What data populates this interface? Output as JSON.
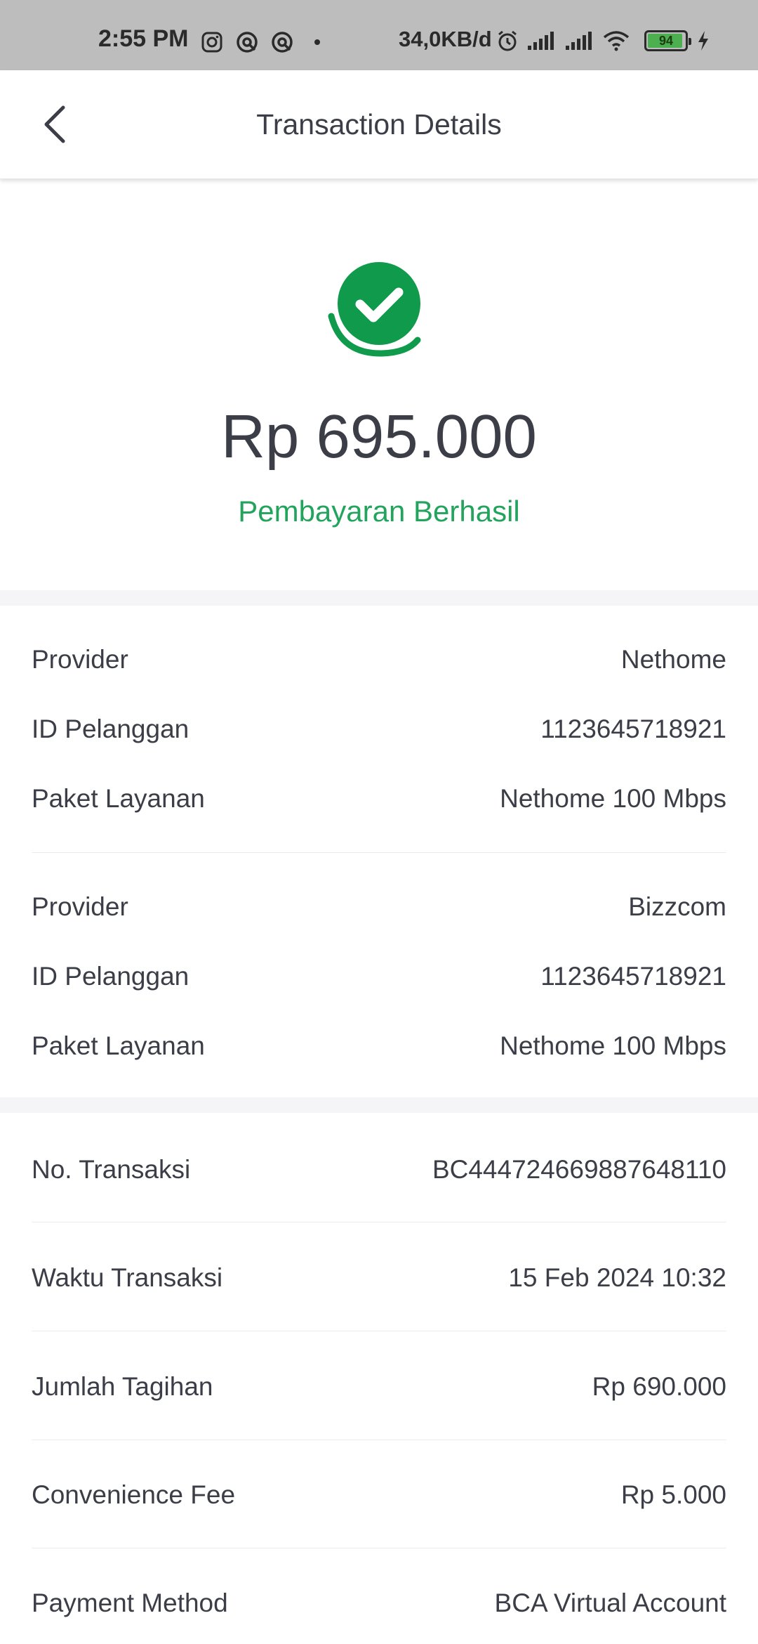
{
  "status_bar": {
    "time": "2:55 PM",
    "net_speed": "34,0KB/d",
    "battery": "94",
    "battery_level": 0.94,
    "icons": [
      "instagram-icon",
      "app-icon",
      "app-icon",
      "alarm-icon",
      "signal-icon",
      "signal-icon",
      "wifi-icon",
      "battery-icon",
      "charging-icon"
    ]
  },
  "header": {
    "title": "Transaction Details",
    "back_icon": "chevron-left-icon"
  },
  "summary": {
    "amount": "Rp 695.000",
    "status": "Pembayaran Berhasil",
    "status_color": "#22a45d",
    "icon_color": "#0f9b4b"
  },
  "services": [
    {
      "provider_label": "Provider",
      "provider": "Nethome",
      "customer_id_label": "ID Pelanggan",
      "customer_id": "1123645718921",
      "package_label": "Paket Layanan",
      "package": "Nethome 100 Mbps"
    },
    {
      "provider_label": "Provider",
      "provider": "Bizzcom",
      "customer_id_label": "ID Pelanggan",
      "customer_id": "1123645718921",
      "package_label": "Paket Layanan",
      "package": "Nethome 100 Mbps"
    }
  ],
  "transaction": [
    {
      "label": "No. Transaksi",
      "value": "BC444724669887648110"
    },
    {
      "label": "Waktu Transaksi",
      "value": "15 Feb 2024 10:32"
    },
    {
      "label": "Jumlah Tagihan",
      "value": "Rp 690.000"
    },
    {
      "label": "Convenience Fee",
      "value": "Rp 5.000"
    },
    {
      "label": "Payment Method",
      "value": "BCA Virtual Account"
    }
  ]
}
